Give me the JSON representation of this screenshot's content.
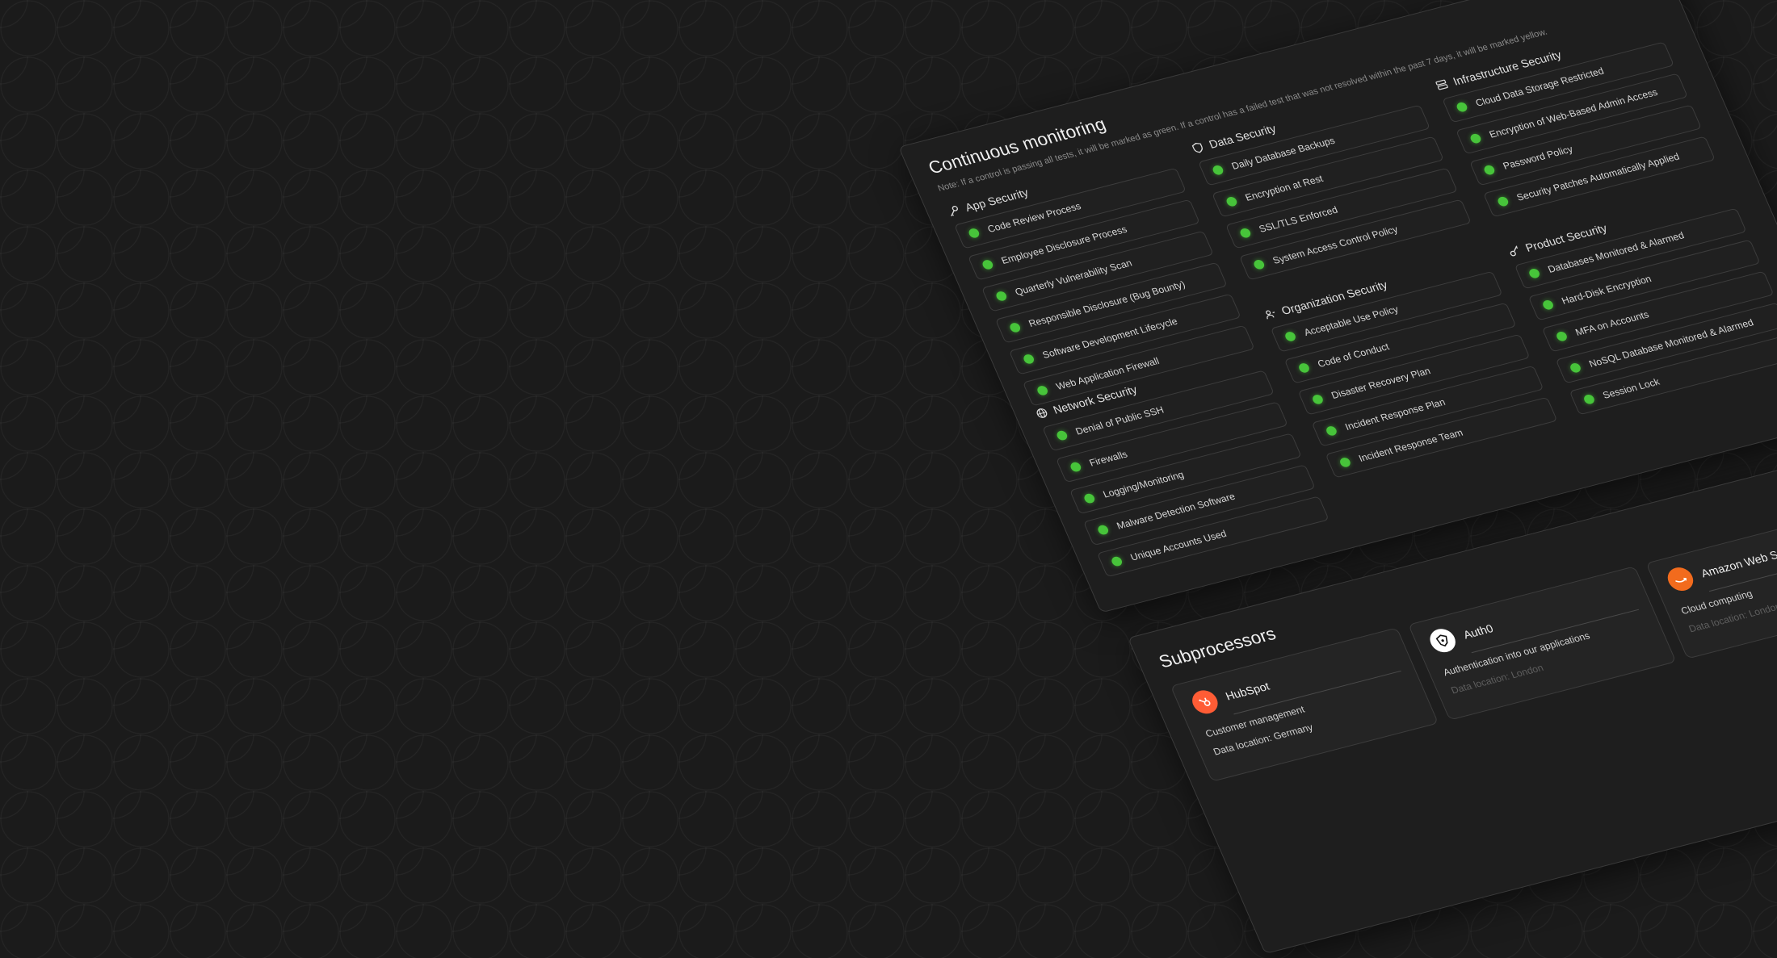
{
  "monitoring": {
    "title": "Continuous monitoring",
    "note": "Note: If a control is passing all tests, it will be marked as green. If a control has a failed test that was not resolved within the past 7 days, it will be marked yellow.",
    "status_color": "#47c43a",
    "sections": {
      "app": {
        "title": "App Security",
        "icon": "key-icon",
        "items": [
          "Code Review Process",
          "Employee Disclosure Process",
          "Quarterly Vulnerability Scan",
          "Responsible Disclosure (Bug Bounty)",
          "Software Development Lifecycle",
          "Web Application Firewall"
        ]
      },
      "data": {
        "title": "Data Security",
        "icon": "shield-icon",
        "items": [
          "Daily Database Backups",
          "Encryption at Rest",
          "SSL/TLS Enforced",
          "System Access Control Policy"
        ]
      },
      "infra": {
        "title": "Infrastructure Security",
        "icon": "server-icon",
        "items": [
          "Cloud Data Storage Restricted",
          "Encryption of Web-Based Admin Access",
          "Password Policy",
          "Security Patches Automatically Applied"
        ]
      },
      "network": {
        "title": "Network Security",
        "icon": "globe-icon",
        "items": [
          "Denial of Public SSH",
          "Firewalls",
          "Logging/Monitoring",
          "Malware Detection Software",
          "Unique Accounts Used"
        ]
      },
      "org": {
        "title": "Organization Security",
        "icon": "users-icon",
        "items": [
          "Acceptable Use Policy",
          "Code of Conduct",
          "Disaster Recovery Plan",
          "Incident Response Plan",
          "Incident Response Team"
        ]
      },
      "product": {
        "title": "Product Security",
        "icon": "key-icon",
        "items": [
          "Databases Monitored & Alarmed",
          "Hard-Disk Encryption",
          "MFA on Accounts",
          "NoSQL Database Monitored & Alarmed",
          "Session Lock"
        ]
      }
    }
  },
  "subprocessors": {
    "title": "Subprocessors",
    "cards": [
      {
        "name": "HubSpot",
        "description": "Customer management",
        "location": "Data location: Germany",
        "logo_color": "#ff5c35",
        "icon": "hubspot-logo-icon"
      },
      {
        "name": "Auth0",
        "description": "Authentication into our applications",
        "location": "Data location: London",
        "logo_color": "#ffffff",
        "icon": "auth0-logo-icon"
      },
      {
        "name": "Amazon Web Services",
        "description": "Cloud computing",
        "location": "Data location: London",
        "logo_color": "#f26b1d",
        "icon": "aws-logo-icon"
      }
    ]
  }
}
